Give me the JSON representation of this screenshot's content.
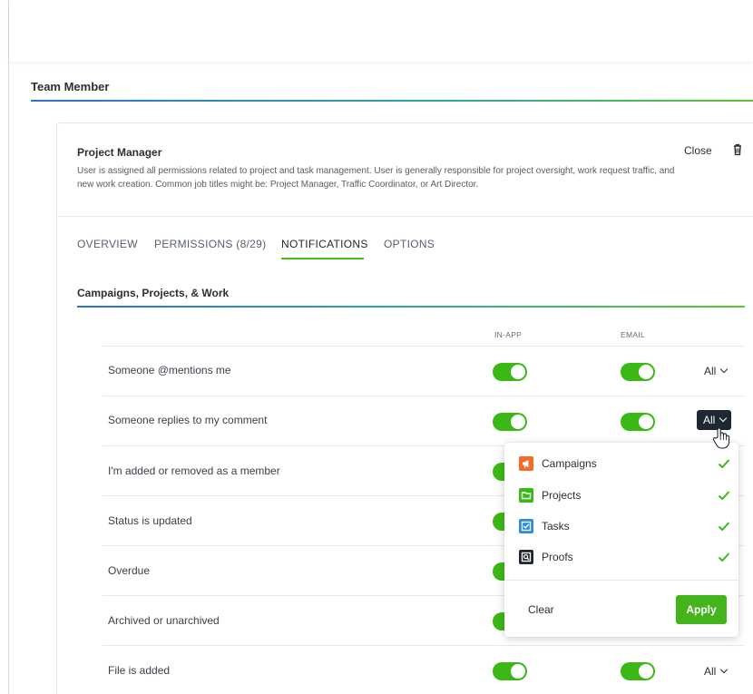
{
  "section": {
    "title": "Team Member"
  },
  "role": {
    "title": "Project Manager",
    "description": "User is assigned all permissions related to project and task management. User is generally responsible for project oversight, work request traffic, and new work creation. Common job titles might be: Project Manager, Traffic Coordinator, or Art Director.",
    "close_label": "Close",
    "trash_icon": "trash-icon"
  },
  "tabs": [
    {
      "label": "OVERVIEW",
      "active": false
    },
    {
      "label": "PERMISSIONS (8/29)",
      "active": false
    },
    {
      "label": "NOTIFICATIONS",
      "active": true
    },
    {
      "label": "OPTIONS",
      "active": false
    }
  ],
  "notifications": {
    "group_title": "Campaigns, Projects, & Work",
    "columns": {
      "in_app": "IN-APP",
      "email": "EMAIL"
    },
    "rows": [
      {
        "label": "Someone @mentions me",
        "in_app": true,
        "email": true,
        "scope": "All"
      },
      {
        "label": "Someone replies to my comment",
        "in_app": true,
        "email": true,
        "scope": "All",
        "open": true
      },
      {
        "label": "I'm added or removed as a member",
        "in_app": true
      },
      {
        "label": "Status is updated",
        "in_app": true
      },
      {
        "label": "Overdue",
        "in_app": true
      },
      {
        "label": "Archived or unarchived",
        "in_app": true
      },
      {
        "label": "File is added",
        "in_app": true,
        "email": true,
        "scope": "All"
      }
    ]
  },
  "dropdown": {
    "items": [
      {
        "label": "Campaigns",
        "icon": "megaphone-icon",
        "color": "#f26b2b",
        "checked": true
      },
      {
        "label": "Projects",
        "icon": "folder-icon",
        "color": "#3cb816",
        "checked": true
      },
      {
        "label": "Tasks",
        "icon": "task-check-icon",
        "color": "#2e8fd6",
        "checked": true
      },
      {
        "label": "Proofs",
        "icon": "proof-icon",
        "color": "#1f2733",
        "checked": true
      }
    ],
    "clear_label": "Clear",
    "apply_label": "Apply"
  },
  "colors": {
    "accent_green": "#3cb816",
    "check_green": "#3cb816",
    "dark_button": "#1f2733"
  }
}
